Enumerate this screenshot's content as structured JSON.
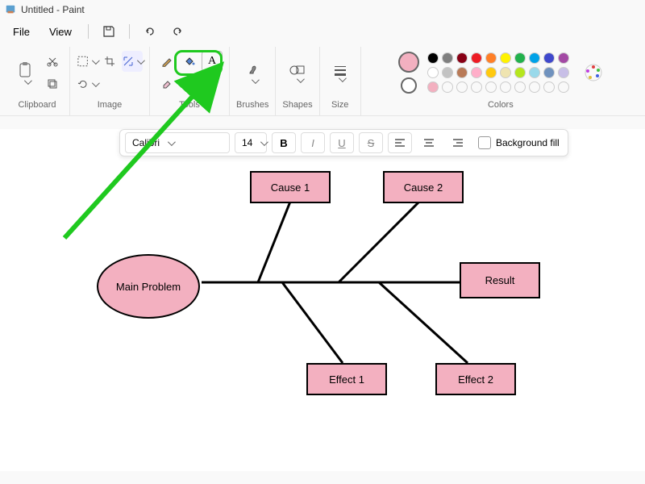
{
  "title": "Untitled - Paint",
  "menu": {
    "file": "File",
    "view": "View"
  },
  "groups": {
    "clipboard": "Clipboard",
    "image": "Image",
    "tools": "Tools",
    "brushes": "Brushes",
    "shapes": "Shapes",
    "size": "Size",
    "colors": "Colors"
  },
  "text_toolbar": {
    "font": "Calibri",
    "size": "14",
    "bold": "B",
    "italic": "I",
    "underline": "U",
    "strike": "S",
    "bgfill_label": "Background fill"
  },
  "colors": {
    "selected1": "#f3b0c0",
    "selected2": "#ffffff",
    "row1": [
      "#000000",
      "#7f7f7f",
      "#880015",
      "#ed1c24",
      "#ff7f27",
      "#fff200",
      "#22b14c",
      "#00a2e8",
      "#3f48cc",
      "#a349a4"
    ],
    "row2": [
      "#ffffff",
      "#c3c3c3",
      "#b97a57",
      "#ffaec9",
      "#ffc90e",
      "#efe4b0",
      "#b5e61d",
      "#99d9ea",
      "#7092be",
      "#c8bfe7"
    ],
    "row3": [
      "#f3b0c0",
      "",
      "",
      "",
      "",
      "",
      "",
      "",
      "",
      ""
    ]
  },
  "diagram": {
    "main": "Main Problem",
    "cause1": "Cause 1",
    "cause2": "Cause 2",
    "effect1": "Effect 1",
    "effect2": "Effect 2",
    "result": "Result"
  }
}
